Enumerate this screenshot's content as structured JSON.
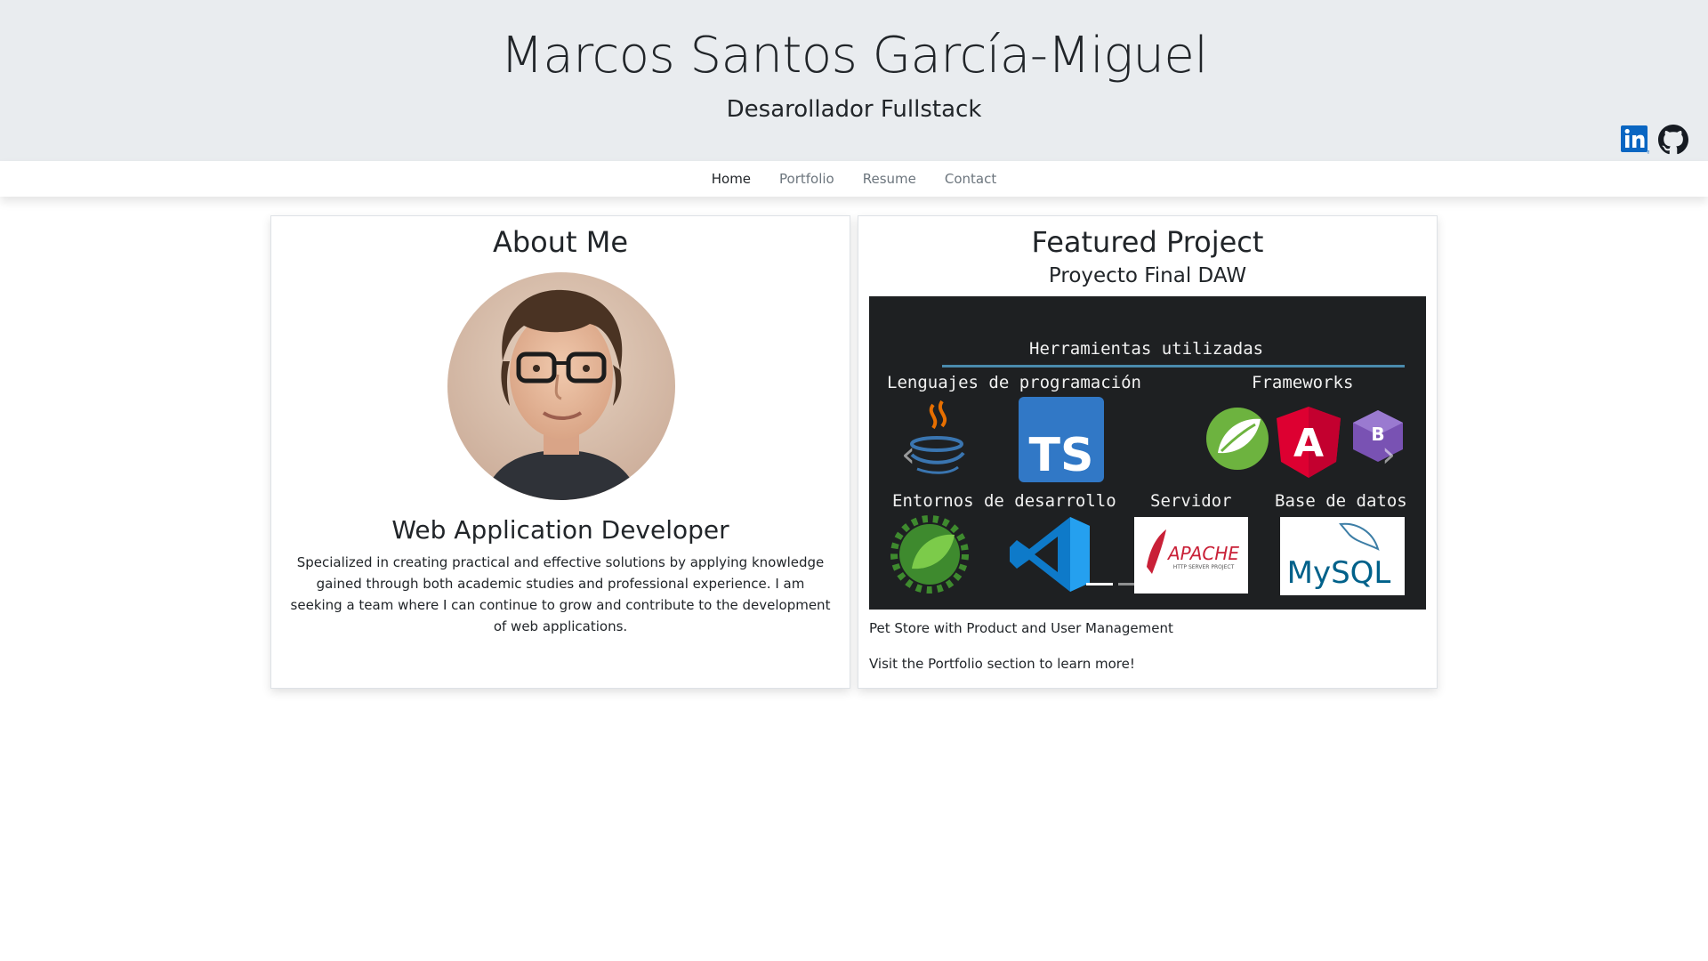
{
  "header": {
    "name": "Marcos Santos García-Miguel",
    "role": "Desarollador Fullstack",
    "social": [
      {
        "icon": "linkedin-icon",
        "color": "#0a66c2"
      },
      {
        "icon": "github-icon",
        "color": "#161b22"
      }
    ]
  },
  "nav": {
    "items": [
      {
        "label": "Home",
        "active": true
      },
      {
        "label": "Portfolio",
        "active": false
      },
      {
        "label": "Resume",
        "active": false
      },
      {
        "label": "Contact",
        "active": false
      }
    ]
  },
  "about": {
    "title": "About Me",
    "subtitle": "Web Application Developer",
    "description": "Specialized in creating practical and effective solutions by applying knowledge gained through both academic studies and professional experience. I am seeking a team where I can continue to grow and contribute to the development of web applications."
  },
  "featured": {
    "title": "Featured Project",
    "project_name": "Proyecto Final DAW",
    "slide": {
      "heading": "Herramientas utilizadas",
      "lenguajes": "Lenguajes de programación",
      "frameworks": "Frameworks",
      "entornos": "Entornos de desarrollo",
      "servidor": "Servidor",
      "base_datos": "Base de datos",
      "ts_label": "TS",
      "angular_label": "A",
      "bootstrap_label": "B",
      "apache_label": "APACHE",
      "apache_sub": "HTTP SERVER PROJECT",
      "mysql_label": "MySQL",
      "icons": [
        "java-icon",
        "typescript-icon",
        "spring-icon",
        "angular-icon",
        "bootstrap-icon",
        "spring-tools-icon",
        "vscode-icon",
        "apache-icon",
        "mysql-icon"
      ]
    },
    "carousel_indicators": 2,
    "active_indicator": 0,
    "description": "Pet Store with Product and User Management",
    "cta": "Visit the Portfolio section to learn more!"
  }
}
